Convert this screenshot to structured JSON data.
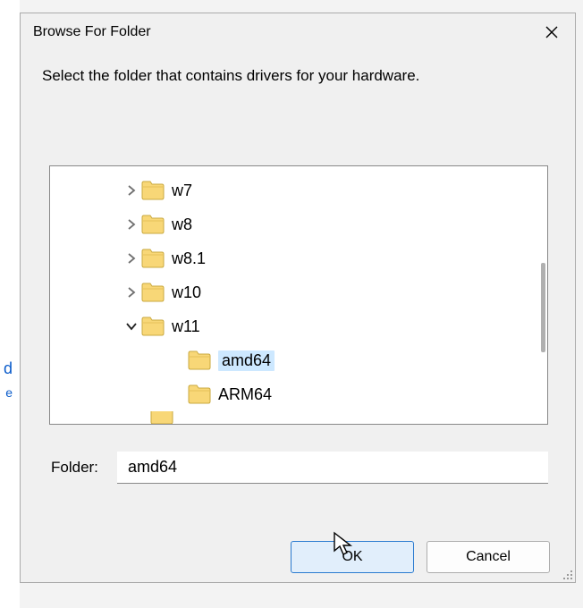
{
  "dialog": {
    "title": "Browse For Folder",
    "instruction": "Select the folder that contains drivers for your hardware."
  },
  "tree": {
    "items": [
      {
        "label": "w7",
        "expanded": false,
        "depth": 0
      },
      {
        "label": "w8",
        "expanded": false,
        "depth": 0
      },
      {
        "label": "w8.1",
        "expanded": false,
        "depth": 0
      },
      {
        "label": "w10",
        "expanded": false,
        "depth": 0
      },
      {
        "label": "w11",
        "expanded": true,
        "depth": 0
      },
      {
        "label": "amd64",
        "expanded": null,
        "depth": 1,
        "selected": true
      },
      {
        "label": "ARM64",
        "expanded": null,
        "depth": 1
      }
    ]
  },
  "folderField": {
    "label": "Folder:",
    "value": "amd64"
  },
  "buttons": {
    "ok": "OK",
    "cancel": "Cancel"
  },
  "background": {
    "d": "d",
    "e": "e"
  }
}
